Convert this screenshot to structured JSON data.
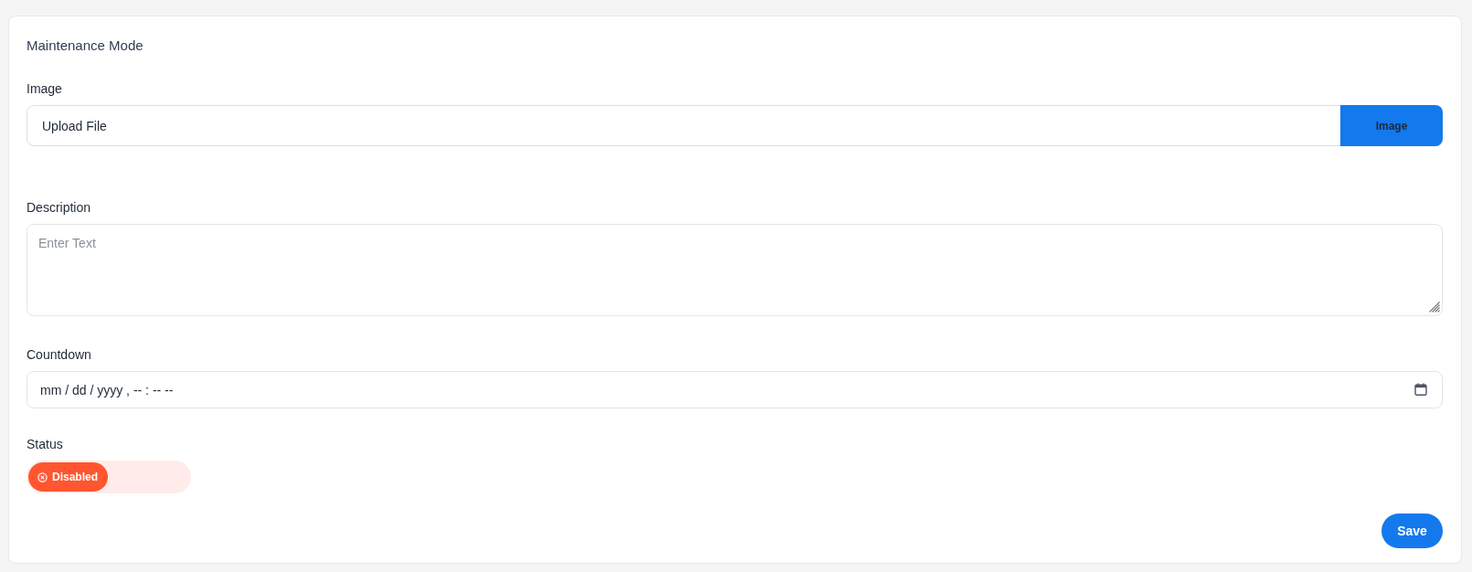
{
  "card": {
    "title": "Maintenance Mode"
  },
  "fields": [
    {
      "kind": "file",
      "label": "Image",
      "value": "Upload File",
      "button": "Image"
    },
    {
      "kind": "textarea",
      "label": "Description",
      "placeholder": "Enter Text"
    },
    {
      "kind": "datetime",
      "label": "Countdown",
      "placeholder": "mm / dd / yyyy , -- : -- --"
    },
    {
      "kind": "toggle",
      "label": "Status",
      "on": false,
      "state_label": "Disabled"
    }
  ],
  "save_button": "Save"
}
